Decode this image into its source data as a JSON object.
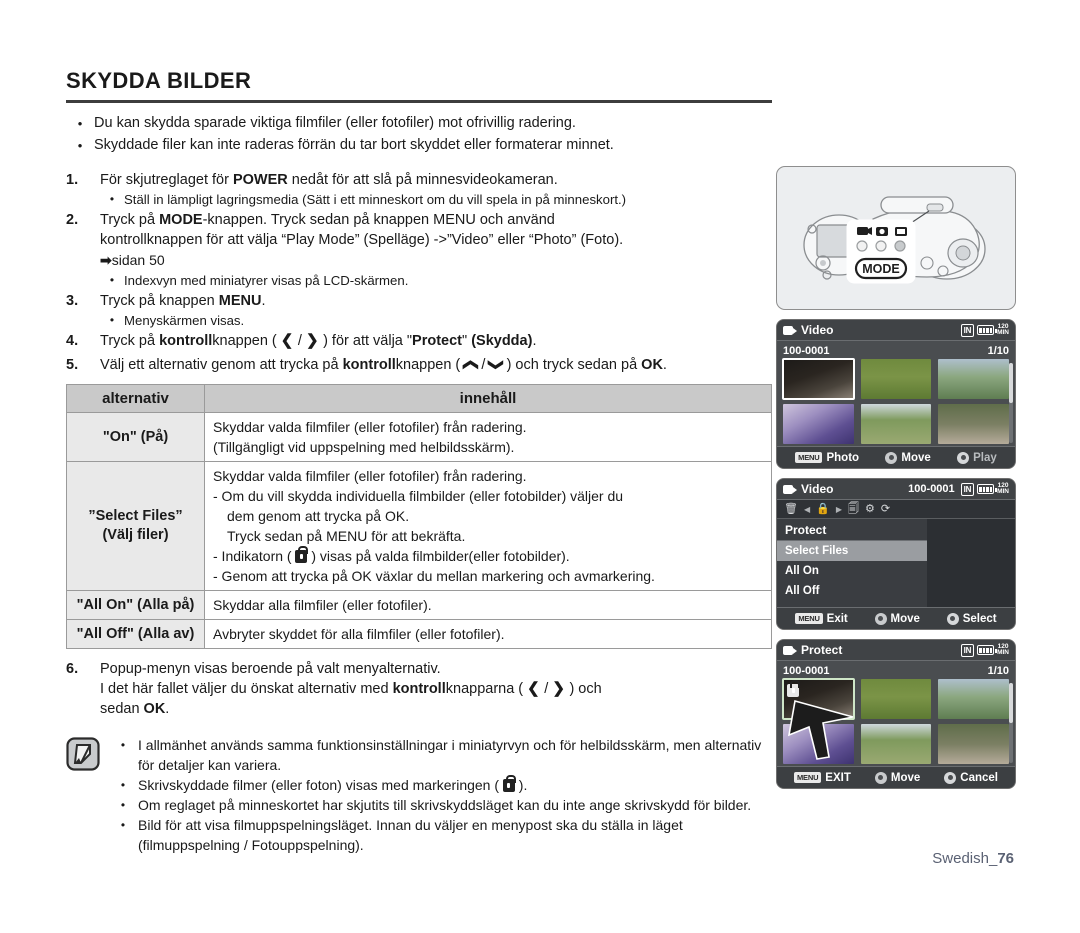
{
  "page": {
    "title": "SKYDDA BILDER",
    "footer_label": "Swedish_",
    "footer_page": "76"
  },
  "intro_bullets": [
    "Du kan skydda sparade viktiga filmfiler (eller fotofiler) mot ofrivillig radering.",
    "Skyddade filer kan inte raderas förrän du tar bort skyddet eller formaterar minnet."
  ],
  "steps": {
    "s1": {
      "num": "1.",
      "text_a": "För skjutreglaget för ",
      "bold_a": "POWER",
      "text_b": " nedåt för att slå på minnesvideokameran.",
      "sub": "Ställ in lämpligt lagringsmedia (Sätt i ett minneskort om du vill spela in på minneskort.)"
    },
    "s2": {
      "num": "2.",
      "text_a": "Tryck på ",
      "bold_a": "MODE",
      "text_b": "-knappen. Tryck sedan på knappen MENU och använd",
      "line2": "kontrollknappen för att välja “Play Mode” (Spelläge) ->”Video” eller “Photo” (Foto).",
      "pageref": "sidan 50",
      "sub": "Indexvyn med miniatyrer visas på LCD-skärmen."
    },
    "s3": {
      "num": "3.",
      "text_a": "Tryck på knappen ",
      "bold_a": "MENU",
      "text_b": ".",
      "sub": "Menyskärmen visas."
    },
    "s4": {
      "num": "4.",
      "text_a": "Tryck på ",
      "bold_a": "kontroll",
      "text_b": "knappen ( ",
      "key_left": "❮",
      "key_sep": " / ",
      "key_right": "❯",
      "text_c": " ) för att välja \"",
      "bold_b": "Protect",
      "text_d": "\" ",
      "bold_c": "(Skydda)",
      "text_e": "."
    },
    "s5": {
      "num": "5.",
      "text_a": "Välj ett alternativ genom att trycka på ",
      "bold_a": "kontroll",
      "text_b": "knappen ( ",
      "key_up": "❮",
      "key_sep": " / ",
      "key_down": "❯",
      "text_c": " ) och tryck sedan på ",
      "bold_b": "OK",
      "text_d": "."
    },
    "s6": {
      "num": "6.",
      "line1": "Popup-menyn visas beroende på valt menyalternativ.",
      "line2_a": "I det här fallet väljer du önskat alternativ med ",
      "line2_bold": "kontroll",
      "line2_b": "knapparna ( ",
      "key_left": "❮",
      "key_sep": " / ",
      "key_right": "❯",
      "line2_c": " ) och",
      "line3_a": "sedan ",
      "line3_bold": "OK",
      "line3_b": "."
    }
  },
  "table": {
    "headers": [
      "alternativ",
      "innehåll"
    ],
    "rows": [
      {
        "name_line1": "\"On\" (På)",
        "name_line2": "",
        "desc": [
          {
            "text": "Skyddar valda filmfiler (eller fotofiler) från radering.",
            "indent": false
          },
          {
            "text": "(Tillgängligt vid uppspelning med helbildsskärm).",
            "indent": false
          }
        ]
      },
      {
        "name_line1": "”Select Files”",
        "name_line2": "(Välj filer)",
        "desc": [
          {
            "text": "Skyddar valda filmfiler (eller fotofiler) från radering.",
            "indent": false
          },
          {
            "text": "- Om du vill skydda individuella filmbilder (eller fotobilder) väljer du",
            "indent": false
          },
          {
            "text": "dem genom att trycka på OK.",
            "indent": true,
            "bold_word": "OK"
          },
          {
            "text": "Tryck sedan på MENU för att bekräfta.",
            "indent": true,
            "bold_word": "MENU"
          },
          {
            "text": "- Indikatorn (  ) visas på valda filmbilder(eller fotobilder).",
            "indent": false,
            "has_lock": true
          },
          {
            "text": "- Genom att trycka på OK växlar du mellan markering och avmarkering.",
            "indent": false,
            "bold_word": "OK"
          }
        ]
      },
      {
        "name_line1": "\"All On\"",
        "name_line2": "(Alla på)",
        "desc": [
          {
            "text": "Skyddar alla filmfiler (eller fotofiler).",
            "indent": false
          }
        ]
      },
      {
        "name_line1": "\"All Off\"",
        "name_line2": "(Alla av)",
        "desc": [
          {
            "text": "Avbryter skyddet för alla filmfiler (eller fotofiler).",
            "indent": false
          }
        ]
      }
    ]
  },
  "notes": [
    "I allmänhet används samma funktionsinställningar i miniatyrvyn och för helbildsskärm, men alternativ för detaljer kan variera.",
    "Skrivskyddade filmer (eller foton) visas med markeringen (  ).",
    "Om reglaget på minneskortet har skjutits till skrivskyddsläget kan du inte ange skrivskydd för bilder.",
    "Bild för att visa filmuppspelningsläget. Innan du väljer en menypost ska du ställa in läget (filmuppspelning / Fotouppspelning)."
  ],
  "illustration": {
    "mode_button_label": "MODE"
  },
  "lcd1": {
    "title": "Video",
    "file_no": "100-0001",
    "counter": "1/10",
    "status": {
      "media": "IN",
      "minutes_top": "120",
      "minutes_bot": "MIN"
    },
    "bottom": {
      "menu_badge": "MENU",
      "menu_label": "Photo",
      "move_label": "Move",
      "play_label": "Play"
    }
  },
  "lcd2": {
    "title": "Video",
    "file_no": "100-0001",
    "status": {
      "media": "IN",
      "minutes_top": "120",
      "minutes_bot": "MIN"
    },
    "menu_head": "Protect",
    "items": [
      {
        "label": "Select Files",
        "selected": true
      },
      {
        "label": "All On",
        "selected": false
      },
      {
        "label": "All Off",
        "selected": false
      }
    ],
    "bottom": {
      "menu_badge": "MENU",
      "exit_label": "Exit",
      "move_label": "Move",
      "select_label": "Select"
    }
  },
  "lcd3": {
    "title": "Protect",
    "file_no": "100-0001",
    "counter": "1/10",
    "status": {
      "media": "IN",
      "minutes_top": "120",
      "minutes_bot": "MIN"
    },
    "bottom": {
      "menu_badge": "MENU",
      "exit_label": "EXIT",
      "move_label": "Move",
      "cancel_label": "Cancel"
    }
  }
}
